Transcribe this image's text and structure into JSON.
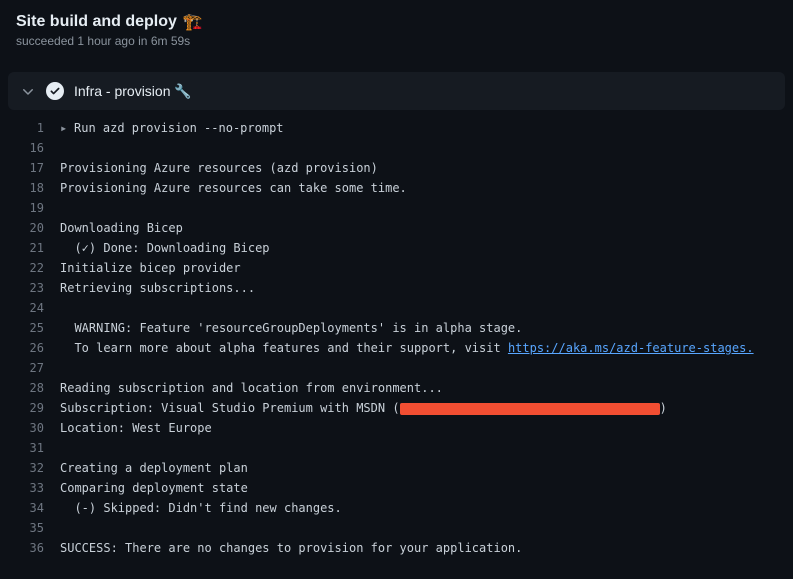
{
  "header": {
    "title": "Site build and deploy",
    "emoji": "🏗️",
    "status_prefix": "succeeded",
    "status_time": "1 hour ago",
    "status_in": "in",
    "status_duration": "6m 59s"
  },
  "step": {
    "name": "Infra - provision 🔧"
  },
  "log": {
    "summary_line": {
      "no": "1",
      "text": "Run azd provision --no-prompt"
    },
    "lines": [
      {
        "no": "16",
        "text": ""
      },
      {
        "no": "17",
        "text": "Provisioning Azure resources (azd provision)"
      },
      {
        "no": "18",
        "text": "Provisioning Azure resources can take some time."
      },
      {
        "no": "19",
        "text": ""
      },
      {
        "no": "20",
        "text": "Downloading Bicep"
      },
      {
        "no": "21",
        "text": "  (✓) Done: Downloading Bicep"
      },
      {
        "no": "22",
        "text": "Initialize bicep provider"
      },
      {
        "no": "23",
        "text": "Retrieving subscriptions..."
      },
      {
        "no": "24",
        "text": ""
      },
      {
        "no": "25",
        "text": "  WARNING: Feature 'resourceGroupDeployments' is in alpha stage."
      },
      {
        "no": "26",
        "prefix": "  To learn more about alpha features and their support, visit ",
        "link_text": "https://aka.ms/azd-feature-stages.",
        "link": true
      },
      {
        "no": "27",
        "text": ""
      },
      {
        "no": "28",
        "text": "Reading subscription and location from environment..."
      },
      {
        "no": "29",
        "prefix": "Subscription: Visual Studio Premium with MSDN (",
        "redacted": true,
        "suffix": ")"
      },
      {
        "no": "30",
        "text": "Location: West Europe"
      },
      {
        "no": "31",
        "text": ""
      },
      {
        "no": "32",
        "text": "Creating a deployment plan"
      },
      {
        "no": "33",
        "text": "Comparing deployment state"
      },
      {
        "no": "34",
        "text": "  (-) Skipped: Didn't find new changes."
      },
      {
        "no": "35",
        "text": ""
      },
      {
        "no": "36",
        "text": "SUCCESS: There are no changes to provision for your application."
      }
    ]
  }
}
